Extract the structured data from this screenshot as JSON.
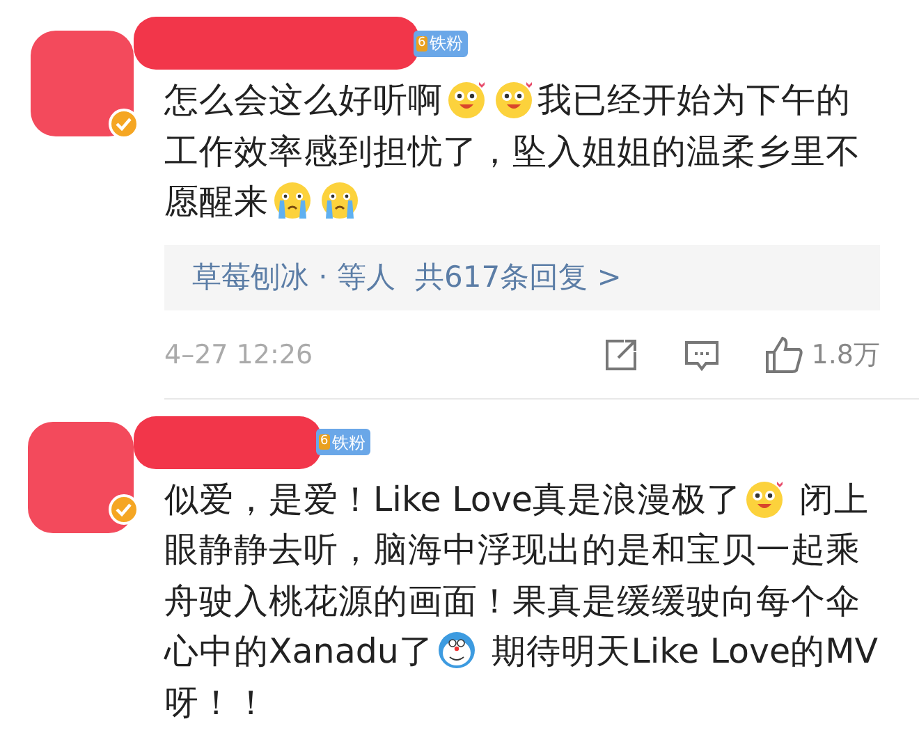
{
  "comments": [
    {
      "verified": true,
      "fan_badge": {
        "rank": "6",
        "label": "铁粉"
      },
      "content": [
        {
          "kind": "text",
          "text": "怎么会这么好听啊"
        },
        {
          "kind": "smitten"
        },
        {
          "kind": "smitten"
        },
        {
          "kind": "text",
          "text": "我已经开始为下午的工作效率感到担忧了，坠入姐姐的温柔乡里不愿醒来"
        },
        {
          "kind": "crying"
        },
        {
          "kind": "crying"
        }
      ],
      "replies": {
        "names": "草莓刨冰 · 等人",
        "count": "共617条回复 >"
      },
      "time": "4–27 12:26",
      "likes": "1.8万"
    },
    {
      "verified": true,
      "fan_badge": {
        "rank": "6",
        "label": "铁粉"
      },
      "content": [
        {
          "kind": "text",
          "text": "似爱，是爱！Like Love真是浪漫极了"
        },
        {
          "kind": "smitten"
        },
        {
          "kind": "text",
          "text": " 闭上眼静静去听，脑海中浮现出的是和宝贝一起乘舟驶入桃花源的画面！果真是缓缓驶向每个伞心中的Xanadu了"
        },
        {
          "kind": "mascot"
        },
        {
          "kind": "text",
          "text": " 期待明天Like Love的MV呀！！"
        }
      ]
    }
  ]
}
